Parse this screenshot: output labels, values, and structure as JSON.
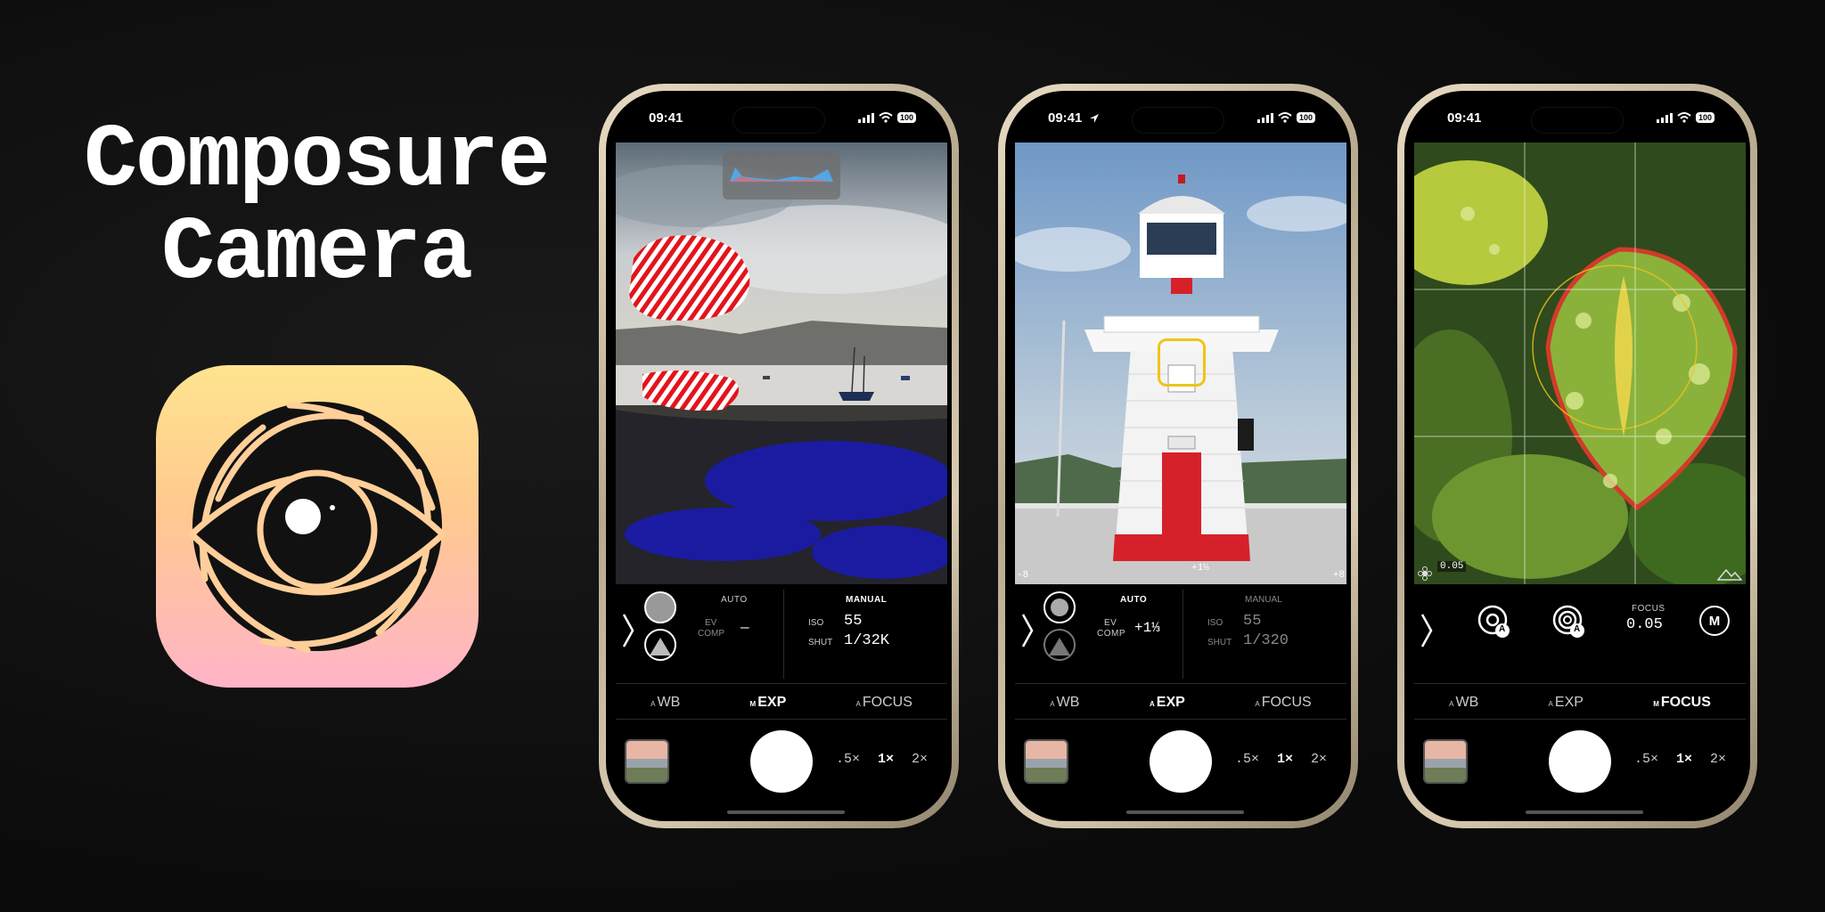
{
  "title": {
    "line1": "Composure",
    "line2": "Camera"
  },
  "colors": {
    "icon_gradient_top": "#ffe48f",
    "icon_gradient_bottom": "#ffb4c8",
    "focus_ring": "#f0c419"
  },
  "phones": [
    {
      "status": {
        "time": "09:41",
        "battery": "100"
      },
      "controls": {
        "left_header": "AUTO",
        "ev_label_1": "EV",
        "ev_label_2": "COMP",
        "ev_value": "—",
        "right_header": "MANUAL",
        "iso_label": "ISO",
        "iso_value": "55",
        "shut_label": "SHUT",
        "shut_value": "1/32K"
      },
      "modes": [
        {
          "prefix": "A",
          "label": "WB"
        },
        {
          "prefix": "M",
          "label": "EXP"
        },
        {
          "prefix": "A",
          "label": "FOCUS"
        }
      ],
      "zoom": [
        ".5×",
        "1×",
        "2×"
      ]
    },
    {
      "status": {
        "time": "09:41",
        "battery": "100"
      },
      "viewfinder": {
        "ev_min": "-8",
        "ev_max": "+8",
        "ev_marker": "+1⅓"
      },
      "controls": {
        "left_header": "AUTO",
        "ev_label_1": "EV",
        "ev_label_2": "COMP",
        "ev_value": "+1⅓",
        "right_header": "MANUAL",
        "iso_label": "ISO",
        "iso_value": "55",
        "shut_label": "SHUT",
        "shut_value": "1/320"
      },
      "modes": [
        {
          "prefix": "A",
          "label": "WB"
        },
        {
          "prefix": "A",
          "label": "EXP"
        },
        {
          "prefix": "A",
          "label": "FOCUS"
        }
      ],
      "zoom": [
        ".5×",
        "1×",
        "2×"
      ]
    },
    {
      "status": {
        "time": "09:41",
        "battery": "100"
      },
      "viewfinder": {
        "focus_readout": "0.05"
      },
      "controls": {
        "focus_label": "FOCUS",
        "focus_value": "0.05",
        "manual_badge": "M",
        "auto_badge": "A"
      },
      "modes": [
        {
          "prefix": "A",
          "label": "WB"
        },
        {
          "prefix": "A",
          "label": "EXP"
        },
        {
          "prefix": "M",
          "label": "FOCUS"
        }
      ],
      "zoom": [
        ".5×",
        "1×",
        "2×"
      ]
    }
  ]
}
